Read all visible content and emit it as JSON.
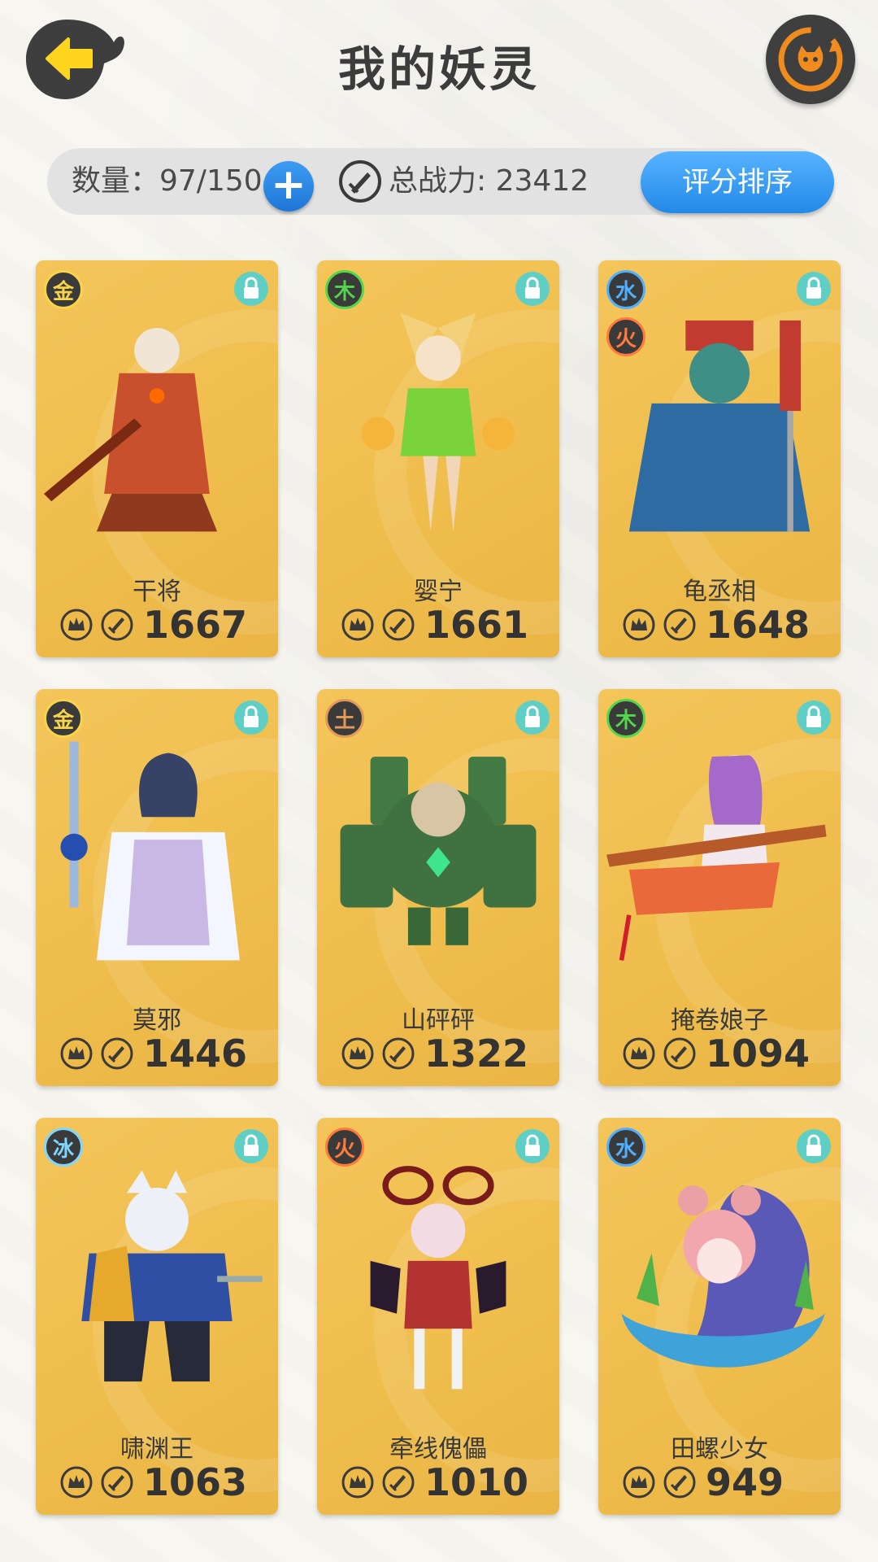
{
  "header": {
    "title": "我的妖灵"
  },
  "stats": {
    "count_label": "数量：97/150",
    "plus": "+",
    "power_label": "总战力: 23412",
    "sort_button": "评分排序"
  },
  "colors": {
    "card_bg": "#efbd4c",
    "sort_btn": "#2389e8",
    "plus_btn": "#1f76d6",
    "lock": "#5fcfc6",
    "element_badge_bg": "#3a3a3a"
  },
  "cards": [
    {
      "name": "干将",
      "power": "1667",
      "elements": [
        {
          "label": "金",
          "color": "#f6d54a"
        }
      ],
      "art": "red-warrior"
    },
    {
      "name": "婴宁",
      "power": "1661",
      "elements": [
        {
          "label": "木",
          "color": "#54d64c"
        }
      ],
      "art": "fox-girl"
    },
    {
      "name": "龟丞相",
      "power": "1648",
      "elements": [
        {
          "label": "水",
          "color": "#4fb0ff"
        },
        {
          "label": "火",
          "color": "#ff7a3c"
        }
      ],
      "art": "turtle-minister"
    },
    {
      "name": "莫邪",
      "power": "1446",
      "elements": [
        {
          "label": "金",
          "color": "#f6d54a"
        }
      ],
      "art": "sword-maiden"
    },
    {
      "name": "山砰砰",
      "power": "1322",
      "elements": [
        {
          "label": "土",
          "color": "#e29a5a"
        }
      ],
      "art": "rock-golem"
    },
    {
      "name": "掩卷娘子",
      "power": "1094",
      "elements": [
        {
          "label": "木",
          "color": "#54d64c"
        }
      ],
      "art": "scroll-lady"
    },
    {
      "name": "啸渊王",
      "power": "1063",
      "elements": [
        {
          "label": "冰",
          "color": "#7fd6ff"
        }
      ],
      "art": "wolf-king"
    },
    {
      "name": "牵线傀儡",
      "power": "1010",
      "elements": [
        {
          "label": "火",
          "color": "#ff7a3c"
        }
      ],
      "art": "puppet-girl"
    },
    {
      "name": "田螺少女",
      "power": "949",
      "elements": [
        {
          "label": "水",
          "color": "#4fb0ff"
        }
      ],
      "art": "snail-girl"
    }
  ]
}
